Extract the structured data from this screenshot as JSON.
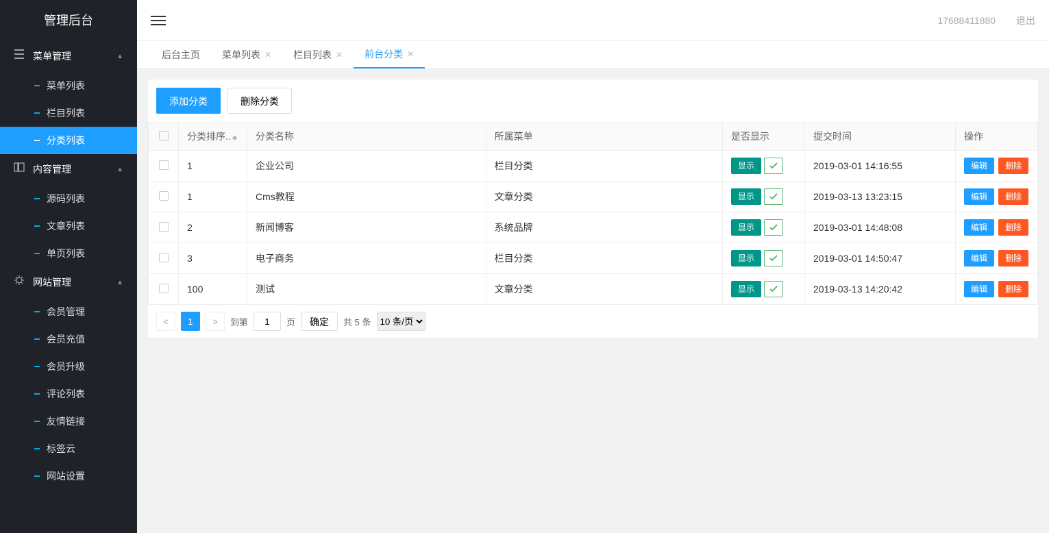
{
  "logo": "管理后台",
  "sidebar": {
    "groups": [
      {
        "title": "菜单管理",
        "items": [
          "菜单列表",
          "栏目列表",
          "分类列表"
        ]
      },
      {
        "title": "内容管理",
        "items": [
          "源码列表",
          "文章列表",
          "单页列表"
        ]
      },
      {
        "title": "网站管理",
        "items": [
          "会员管理",
          "会员充值",
          "会员升级",
          "评论列表",
          "友情链接",
          "标签云",
          "网站设置"
        ]
      }
    ]
  },
  "header": {
    "user": "17688411880",
    "logout": "退出"
  },
  "tabs": [
    {
      "label": "后台主页",
      "closable": false
    },
    {
      "label": "菜单列表",
      "closable": true
    },
    {
      "label": "栏目列表",
      "closable": true
    },
    {
      "label": "前台分类",
      "closable": true,
      "active": true
    }
  ],
  "toolbar": {
    "add": "添加分类",
    "del": "删除分类"
  },
  "table": {
    "headers": [
      "分类排序..",
      "分类名称",
      "所属菜单",
      "是否显示",
      "提交时间",
      "操作"
    ],
    "status_label": "显示",
    "edit": "编辑",
    "delete": "删除",
    "rows": [
      {
        "sort": "1",
        "name": "企业公司",
        "menu": "栏目分类",
        "time": "2019-03-01 14:16:55"
      },
      {
        "sort": "1",
        "name": "Cms教程",
        "menu": "文章分类",
        "time": "2019-03-13 13:23:15"
      },
      {
        "sort": "2",
        "name": "新闻博客",
        "menu": "系统品牌",
        "time": "2019-03-01 14:48:08"
      },
      {
        "sort": "3",
        "name": "电子商务",
        "menu": "栏目分类",
        "time": "2019-03-01 14:50:47"
      },
      {
        "sort": "100",
        "name": "测试",
        "menu": "文章分类",
        "time": "2019-03-13 14:20:42"
      }
    ]
  },
  "pager": {
    "page": "1",
    "goto_label": "到第",
    "page_unit": "页",
    "confirm": "确定",
    "total": "共 5 条",
    "page_size": "10 条/页"
  }
}
